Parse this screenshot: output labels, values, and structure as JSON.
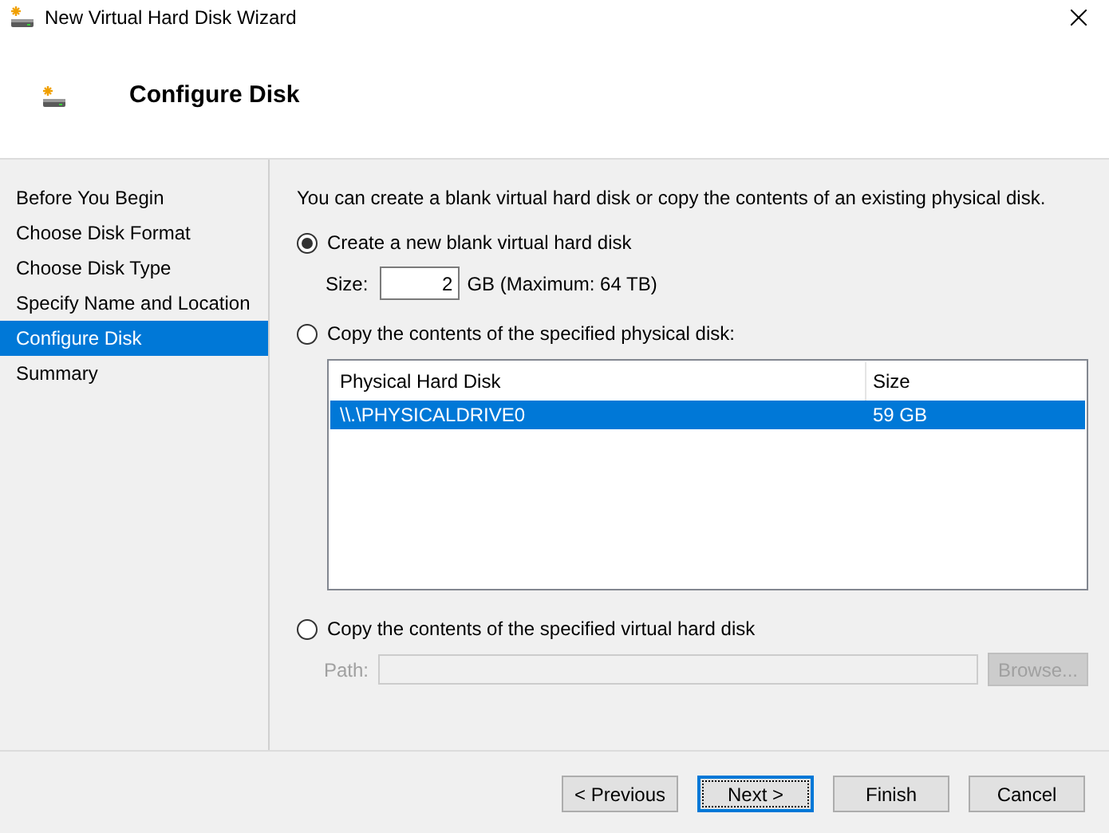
{
  "window": {
    "title": "New Virtual Hard Disk Wizard"
  },
  "header": {
    "title": "Configure Disk"
  },
  "sidebar": {
    "items": [
      {
        "label": "Before You Begin",
        "selected": false
      },
      {
        "label": "Choose Disk Format",
        "selected": false
      },
      {
        "label": "Choose Disk Type",
        "selected": false
      },
      {
        "label": "Specify Name and Location",
        "selected": false
      },
      {
        "label": "Configure Disk",
        "selected": true
      },
      {
        "label": "Summary",
        "selected": false
      }
    ]
  },
  "intro": "You can create a blank virtual hard disk or copy the contents of an existing physical disk.",
  "options": [
    {
      "label": "Create a new blank virtual hard disk",
      "selected": true
    },
    {
      "label": "Copy the contents of the specified physical disk:",
      "selected": false
    },
    {
      "label": "Copy the contents of the specified virtual hard disk",
      "selected": false
    }
  ],
  "size": {
    "label": "Size:",
    "value": "2",
    "unit": "GB (Maximum: 64 TB)"
  },
  "table": {
    "columns": [
      "Physical Hard Disk",
      "Size"
    ],
    "rows": [
      {
        "cells": [
          "\\\\.\\PHYSICALDRIVE0",
          "59 GB"
        ],
        "selected": true
      }
    ]
  },
  "path": {
    "label": "Path:",
    "disabled": true,
    "browse": "Browse..."
  },
  "buttons": [
    {
      "label": "< Previous",
      "focused": false
    },
    {
      "label": "Next >",
      "focused": true
    },
    {
      "label": "Finish",
      "focused": false
    },
    {
      "label": "Cancel",
      "focused": false
    }
  ]
}
